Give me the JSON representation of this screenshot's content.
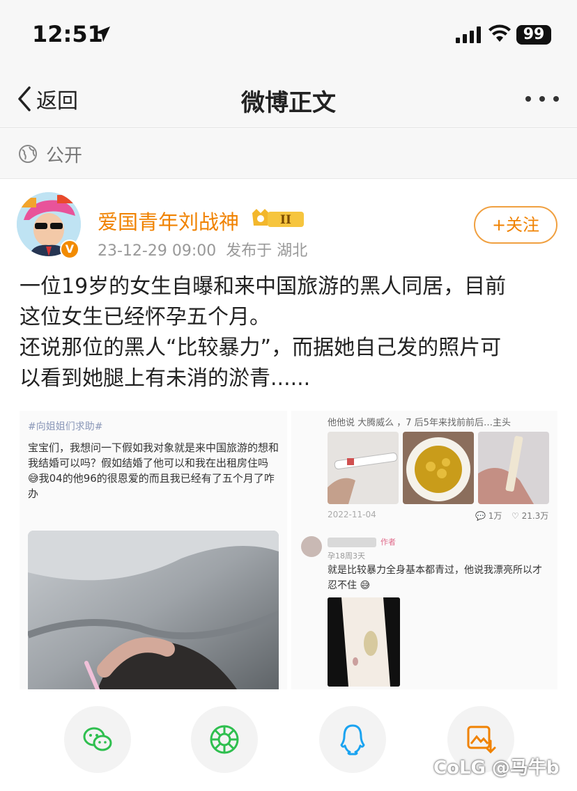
{
  "status_bar": {
    "time": "12:51",
    "battery": "99"
  },
  "nav": {
    "back_label": "返回",
    "title": "微博正文"
  },
  "visibility": {
    "label": "公开"
  },
  "author": {
    "name": "爱国青年刘战神",
    "badge": "II",
    "timestamp": "23-12-29 09:00",
    "location": "发布于 湖北",
    "follow_label": "+关注",
    "verify_mark": "V"
  },
  "post": {
    "lines": [
      "一位19岁的女生自曝和来中国旅游的黑人同居，目前",
      "这位女生已经怀孕五个月。",
      "还说那位的黑人“比较暴力”，而据她自己发的照片可",
      "以看到她腿上有未消的淤青......"
    ]
  },
  "image_left": {
    "tag": "#向姐姐们求助#",
    "text": "宝宝们，我想问一下假如我对象就是来中国旅游的想和我结婚可以吗？假如结婚了他可以和我在出租房住吗 😅我04的他96的很恩爱的而且我已经有了五个月了咋办"
  },
  "image_right": {
    "top_text": "他他说 大腾威么 ，7 后5年来找前前后…主头",
    "date": "2022-11-04",
    "comments": "1万",
    "likes": "21.3万",
    "author_tag": "作者",
    "sub": "孕18周3天",
    "comment": "就是比较暴力全身基本都青过，他说我漂亮所以才忍不住 😅"
  },
  "watermark": "CoLG @马牛b",
  "colors": {
    "accent": "#f08200",
    "wechat": "#2fbf4f",
    "qq": "#1aa3f0"
  }
}
